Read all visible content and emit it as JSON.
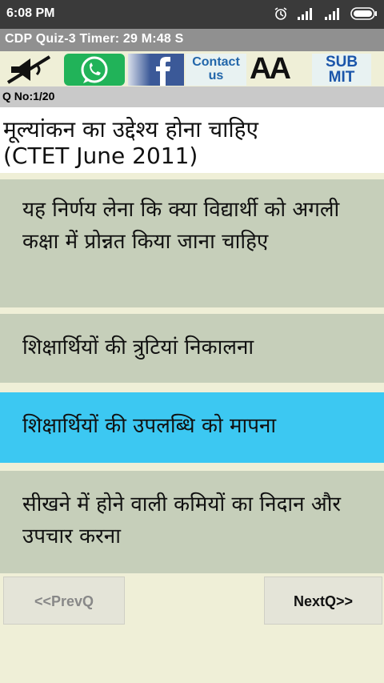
{
  "status": {
    "time": "6:08 PM"
  },
  "app": {
    "title": "CDP Quiz-3   Timer: 29 M:48 S"
  },
  "toolbar": {
    "contact_line1": "Contact",
    "contact_line2": "us",
    "font_label": "AA",
    "submit_line1": "SUB",
    "submit_line2": "MIT"
  },
  "question": {
    "number": "Q No:1/20",
    "line1": "मूल्यांकन का उद्देश्य होना चाहिए",
    "line2": "(CTET June 2011)"
  },
  "options": [
    {
      "text": "यह निर्णय लेना कि क्या विद्यार्थी को अगली कक्षा में प्रोन्नत किया जाना चाहिए"
    },
    {
      "text": "शिक्षार्थियों की त्रुटियां निकालना"
    },
    {
      "text": "शिक्षार्थियों की उपलब्धि को मापना"
    },
    {
      "text": "सीखने में होने वाली कमियों का निदान और उपचार करना"
    }
  ],
  "nav": {
    "prev": "<<PrevQ",
    "next": "NextQ>>"
  },
  "colors": {
    "selected": "#3cc8f2",
    "option": "#c6cfba",
    "background": "#efefd7"
  }
}
